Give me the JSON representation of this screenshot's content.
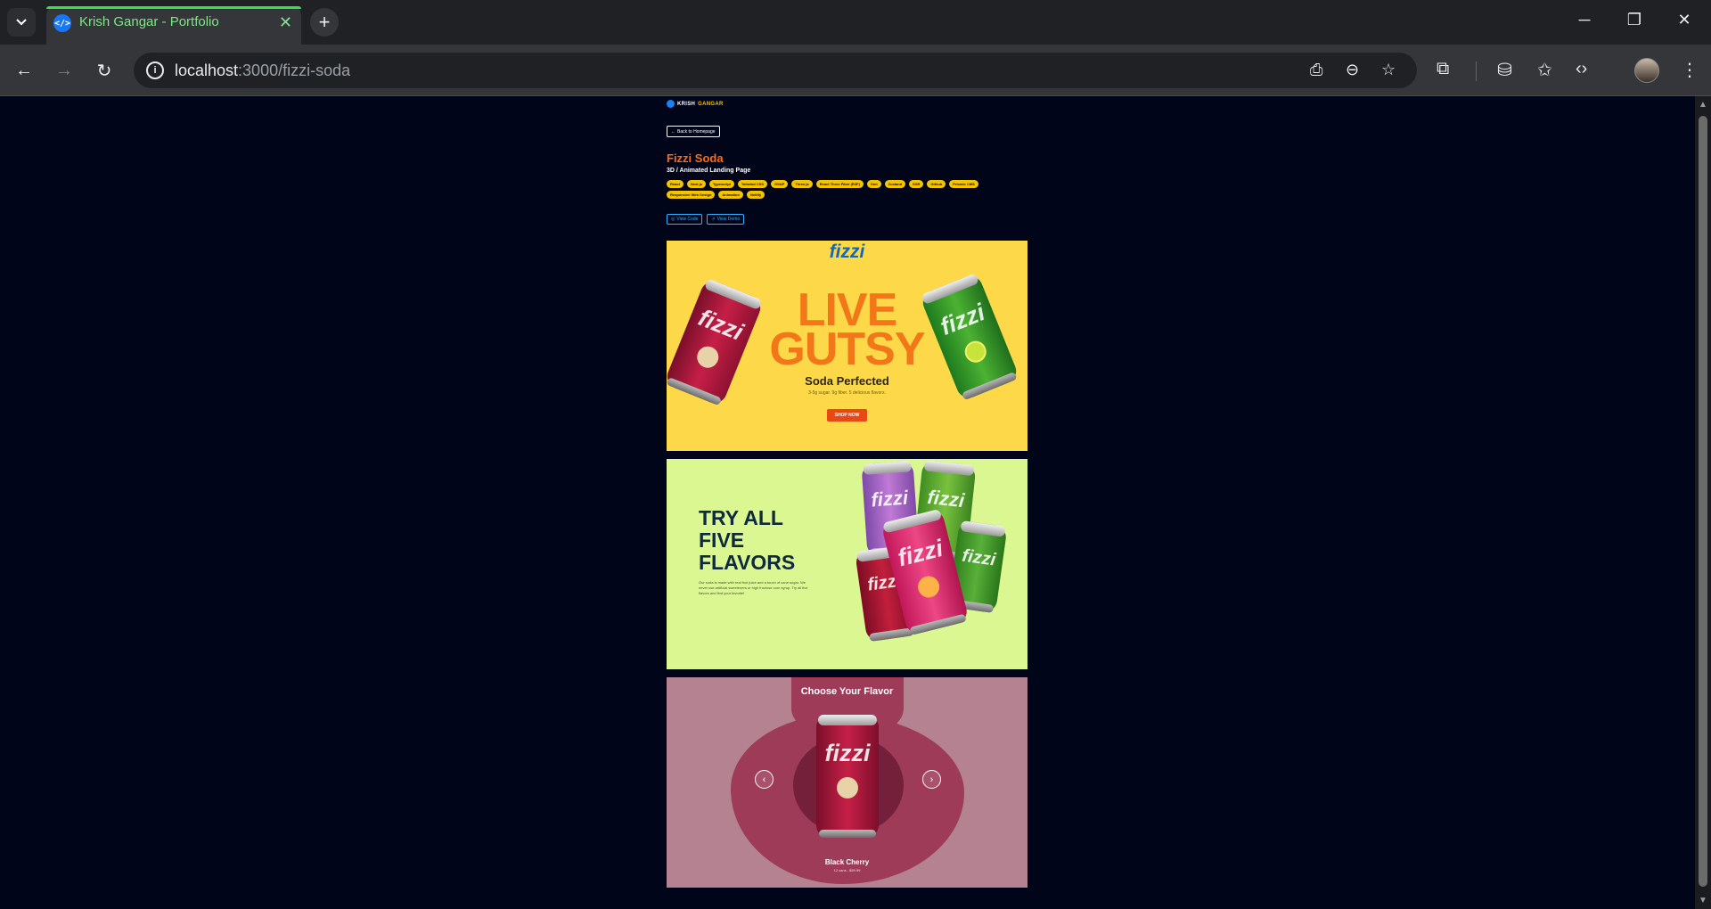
{
  "browser": {
    "tab_title": "Krish Gangar - Portfolio",
    "tab_favicon": "</>",
    "url_host": "localhost",
    "url_path": ":3000/fizzi-soda"
  },
  "page": {
    "logo_first": "KRISH",
    "logo_second": "GANGAR",
    "back_label": "Back to Homepage",
    "title": "Fizzi Soda",
    "subtitle": "3D / Animated Landing Page",
    "tags": [
      "React",
      "Next.js",
      "Typescript",
      "Tailwind CSS",
      "GSAP",
      "Three.js",
      "React Three Fiber (R3F)",
      "Drei",
      "Zustand",
      "SSR",
      "Github",
      "Prismic CMS",
      "Responsive Web Design",
      "Animation",
      "Netlify"
    ],
    "view_code": "View Code",
    "view_demo": "View Demo"
  },
  "hero": {
    "brand": "fizzi",
    "line1": "LIVE",
    "line2": "GUTSY",
    "tagline": "Soda Perfected",
    "subtext": "3-5g sugar. 9g fiber. 5 delicious flavors.",
    "cta": "SHOP NOW"
  },
  "flavors": {
    "heading": [
      "TRY ALL",
      "FIVE",
      "FLAVORS"
    ],
    "copy": "Our soda is made with real fruit juice and a touch of cane sugar. We never use artificial sweeteners or high fructose corn syrup. Try all five flavors and find your favorite!"
  },
  "carousel": {
    "title": "Choose Your Flavor",
    "flavor_name": "Black Cherry",
    "price": "12 cans - $59.99"
  },
  "colors": {
    "accent_orange": "#f27718",
    "tag_yellow": "#f5c400",
    "link_blue": "#2fb3ff",
    "page_bg": "#00051a",
    "tab_accent": "#3ddc4e"
  }
}
